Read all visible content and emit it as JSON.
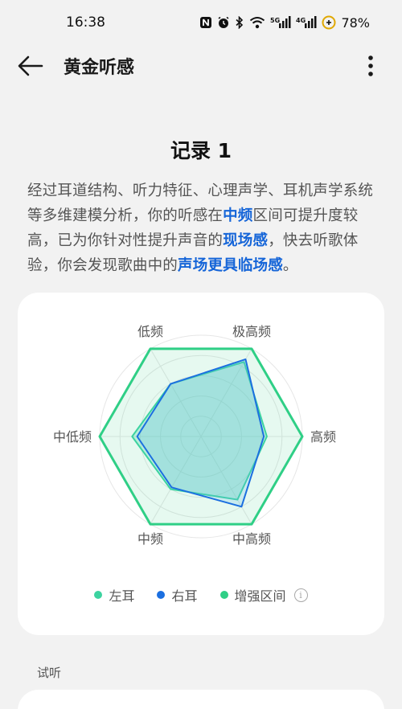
{
  "status_bar": {
    "time": "16:38",
    "icons": [
      "nfc-icon",
      "alarm-icon",
      "bluetooth-icon",
      "wifi-icon",
      "signal-5g-icon",
      "signal-4g-icon",
      "battery-saver-icon"
    ],
    "network_1": "5G",
    "network_2": "4G",
    "battery": "78%"
  },
  "header": {
    "title": "黄金听感",
    "back_icon": "arrow-left-icon",
    "more_icon": "more-vertical-icon"
  },
  "record": {
    "title": "记录 1",
    "description": {
      "p1": "经过耳道结构、听力特征、心理声学、耳机声学系统等多维建模分析，你的听感在",
      "h1": "中频",
      "p2": "区间可提升度较高，已为你针对性提升声音的",
      "h2": "现场感",
      "p3": "，快去听歌体验，你会发现歌曲中的",
      "h3": "声场更具临场感",
      "p4": "。"
    }
  },
  "chart_data": {
    "type": "radar",
    "axes": [
      "极高频",
      "高频",
      "中高频",
      "中频",
      "中低频",
      "低频"
    ],
    "range": [
      0,
      1
    ],
    "series": [
      {
        "name": "左耳",
        "values": [
          0.85,
          0.65,
          0.72,
          0.6,
          0.68,
          0.6
        ],
        "color": "#3cd3a0"
      },
      {
        "name": "右耳",
        "values": [
          0.88,
          0.62,
          0.8,
          0.58,
          0.63,
          0.6
        ],
        "color": "#1b6fe0"
      },
      {
        "name": "增强区间",
        "values": [
          1.0,
          1.0,
          1.0,
          1.0,
          1.0,
          1.0
        ],
        "color": "#2fcf86"
      }
    ],
    "legend": [
      "左耳",
      "右耳",
      "增强区间"
    ],
    "legend_position": "bottom",
    "grid": true
  },
  "legend_colors": {
    "left_ear": "#3cd3a0",
    "right_ear": "#1b6fe0",
    "enhance": "#2fcf86"
  },
  "section": {
    "label": "试听"
  }
}
